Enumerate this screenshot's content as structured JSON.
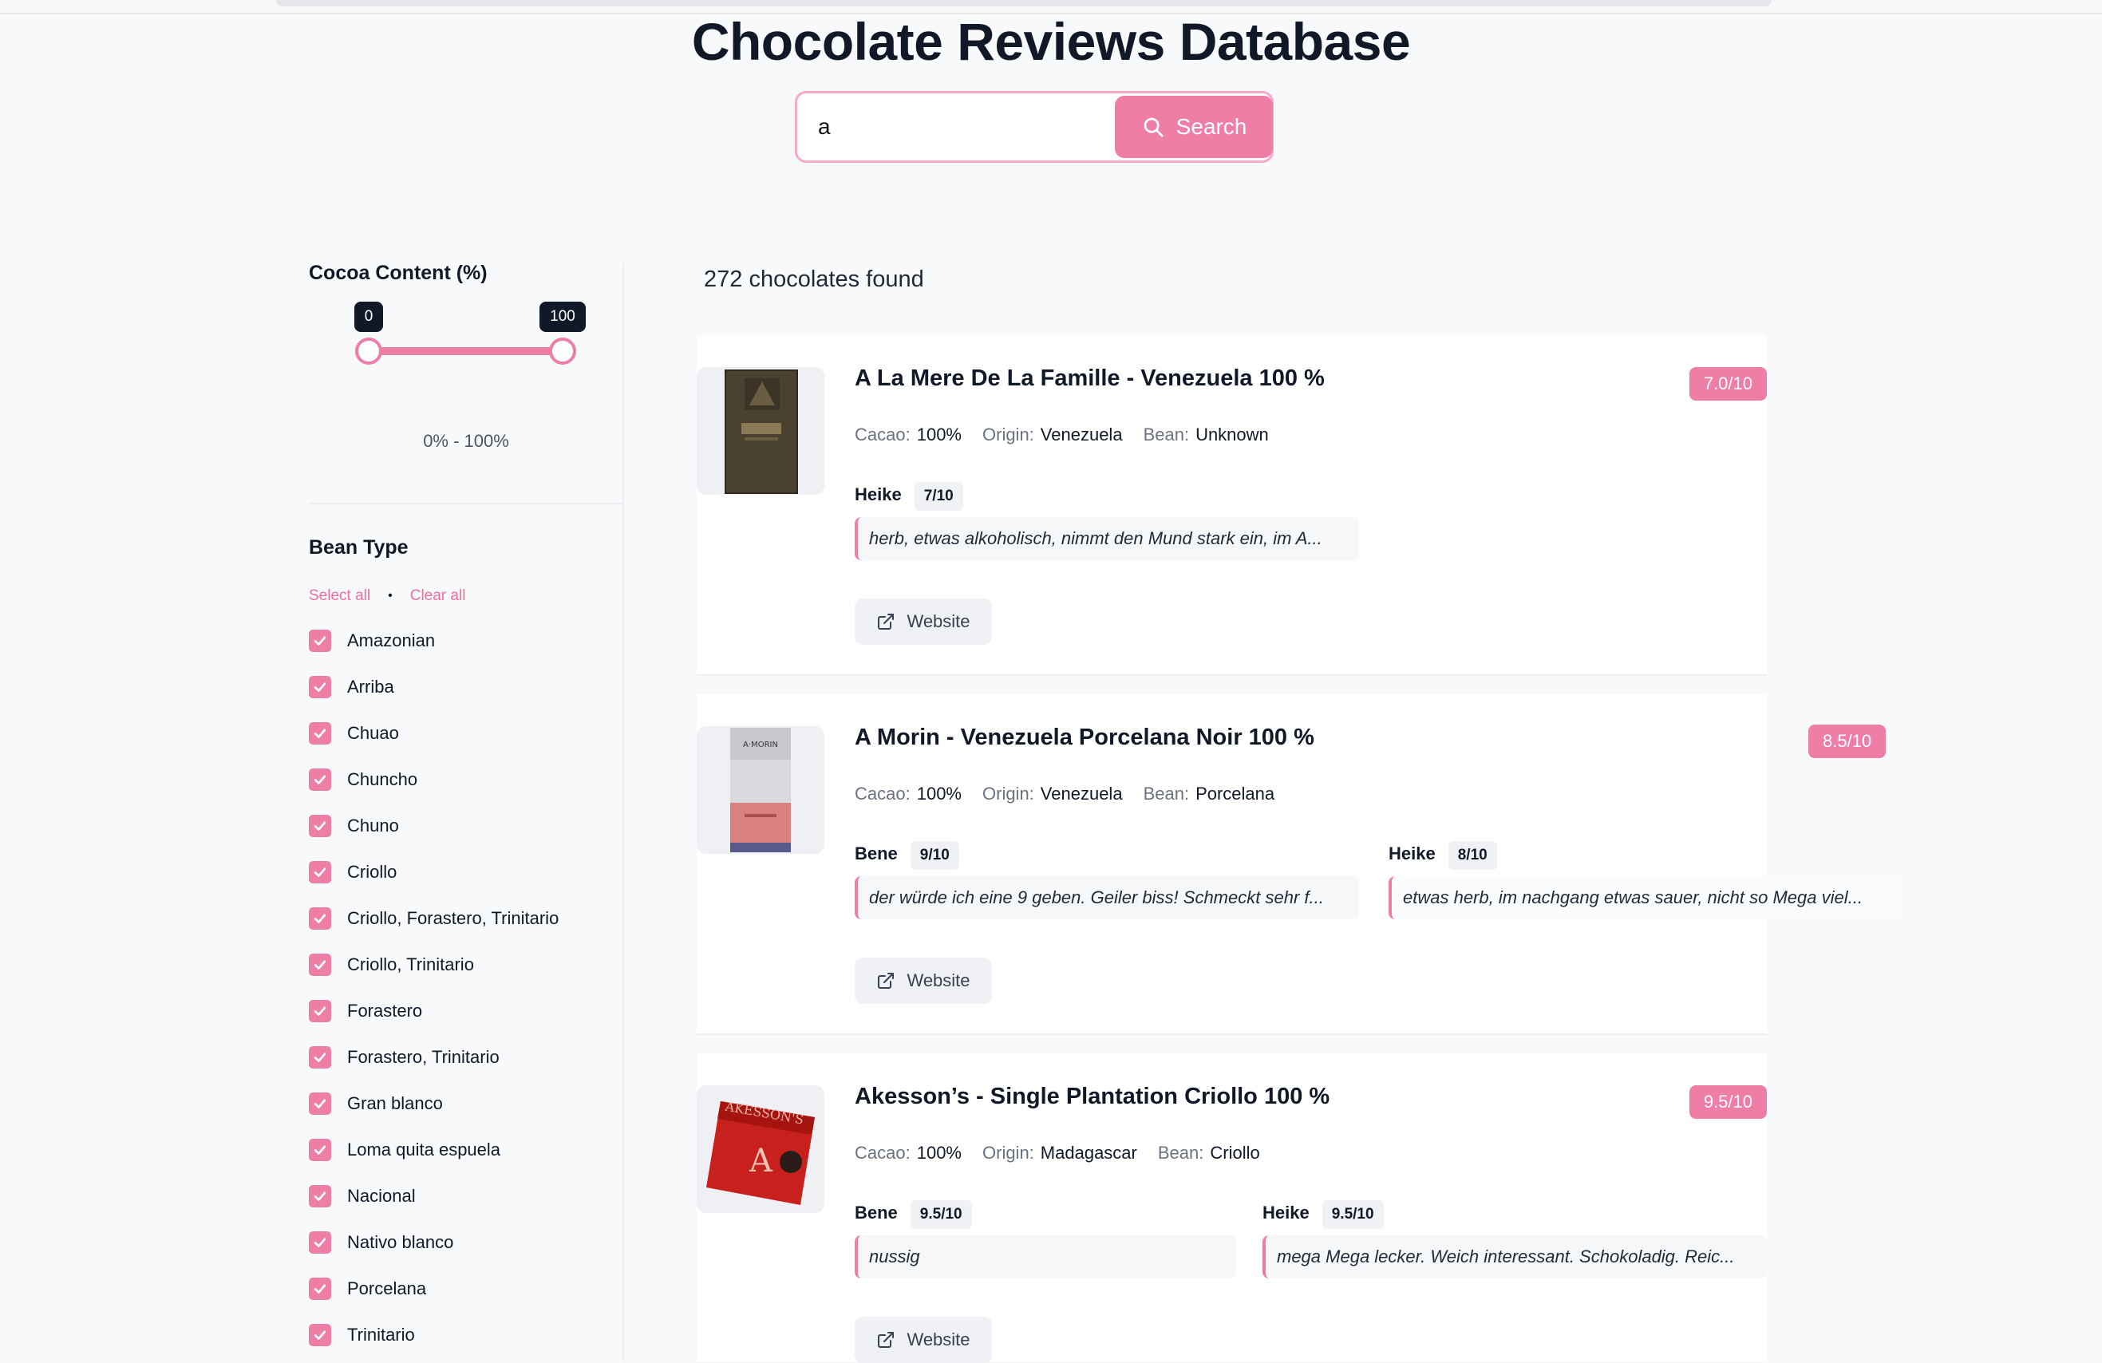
{
  "header": {
    "title": "Chocolate Reviews Database"
  },
  "search": {
    "value": "a",
    "button_label": "Search"
  },
  "filters": {
    "cocoa": {
      "title": "Cocoa Content (%)",
      "min_label": "0",
      "max_label": "100",
      "range_text": "0% - 100%"
    },
    "bean": {
      "title": "Bean Type",
      "select_all": "Select all",
      "separator": "•",
      "clear_all": "Clear all",
      "options": [
        "Amazonian",
        "Arriba",
        "Chuao",
        "Chuncho",
        "Chuno",
        "Criollo",
        "Criollo, Forastero, Trinitario",
        "Criollo, Trinitario",
        "Forastero",
        "Forastero, Trinitario",
        "Gran blanco",
        "Loma quita espuela",
        "Nacional",
        "Nativo blanco",
        "Porcelana",
        "Trinitario"
      ]
    }
  },
  "results": {
    "count_text": "272 chocolates found",
    "meta_labels": {
      "cacao": "Cacao:",
      "origin": "Origin:",
      "bean": "Bean:"
    },
    "website_label": "Website",
    "items": [
      {
        "name": "A La Mere De La Famille - Venezuela 100 %",
        "score": "7.0/10",
        "cacao": "100%",
        "origin": "Venezuela",
        "bean": "Unknown",
        "reviews": [
          {
            "name": "Heike",
            "score": "7/10",
            "text": "herb, etwas alkoholisch, nimmt den Mund stark ein, im A..."
          }
        ]
      },
      {
        "name": "A Morin - Venezuela Porcelana Noir 100 %",
        "score": "8.5/10",
        "cacao": "100%",
        "origin": "Venezuela",
        "bean": "Porcelana",
        "reviews": [
          {
            "name": "Bene",
            "score": "9/10",
            "text": "der würde ich eine 9 geben. Geiler biss! Schmeckt sehr f..."
          },
          {
            "name": "Heike",
            "score": "8/10",
            "text": "etwas herb, im nachgang etwas sauer, nicht so Mega viel..."
          }
        ]
      },
      {
        "name": "Akesson’s - Single Plantation Criollo 100 %",
        "score": "9.5/10",
        "cacao": "100%",
        "origin": "Madagascar",
        "bean": "Criollo",
        "reviews": [
          {
            "name": "Bene",
            "score": "9.5/10",
            "text": "nussig"
          },
          {
            "name": "Heike",
            "score": "9.5/10",
            "text": "mega Mega lecker. Weich interessant. Schokoladig. Reic..."
          }
        ]
      }
    ]
  },
  "colors": {
    "accent": "#ef7ea6",
    "dark": "#111827",
    "background": "#f8f9fb"
  },
  "icons": {
    "search": "search-icon",
    "check": "check-icon",
    "external": "external-link-icon"
  }
}
